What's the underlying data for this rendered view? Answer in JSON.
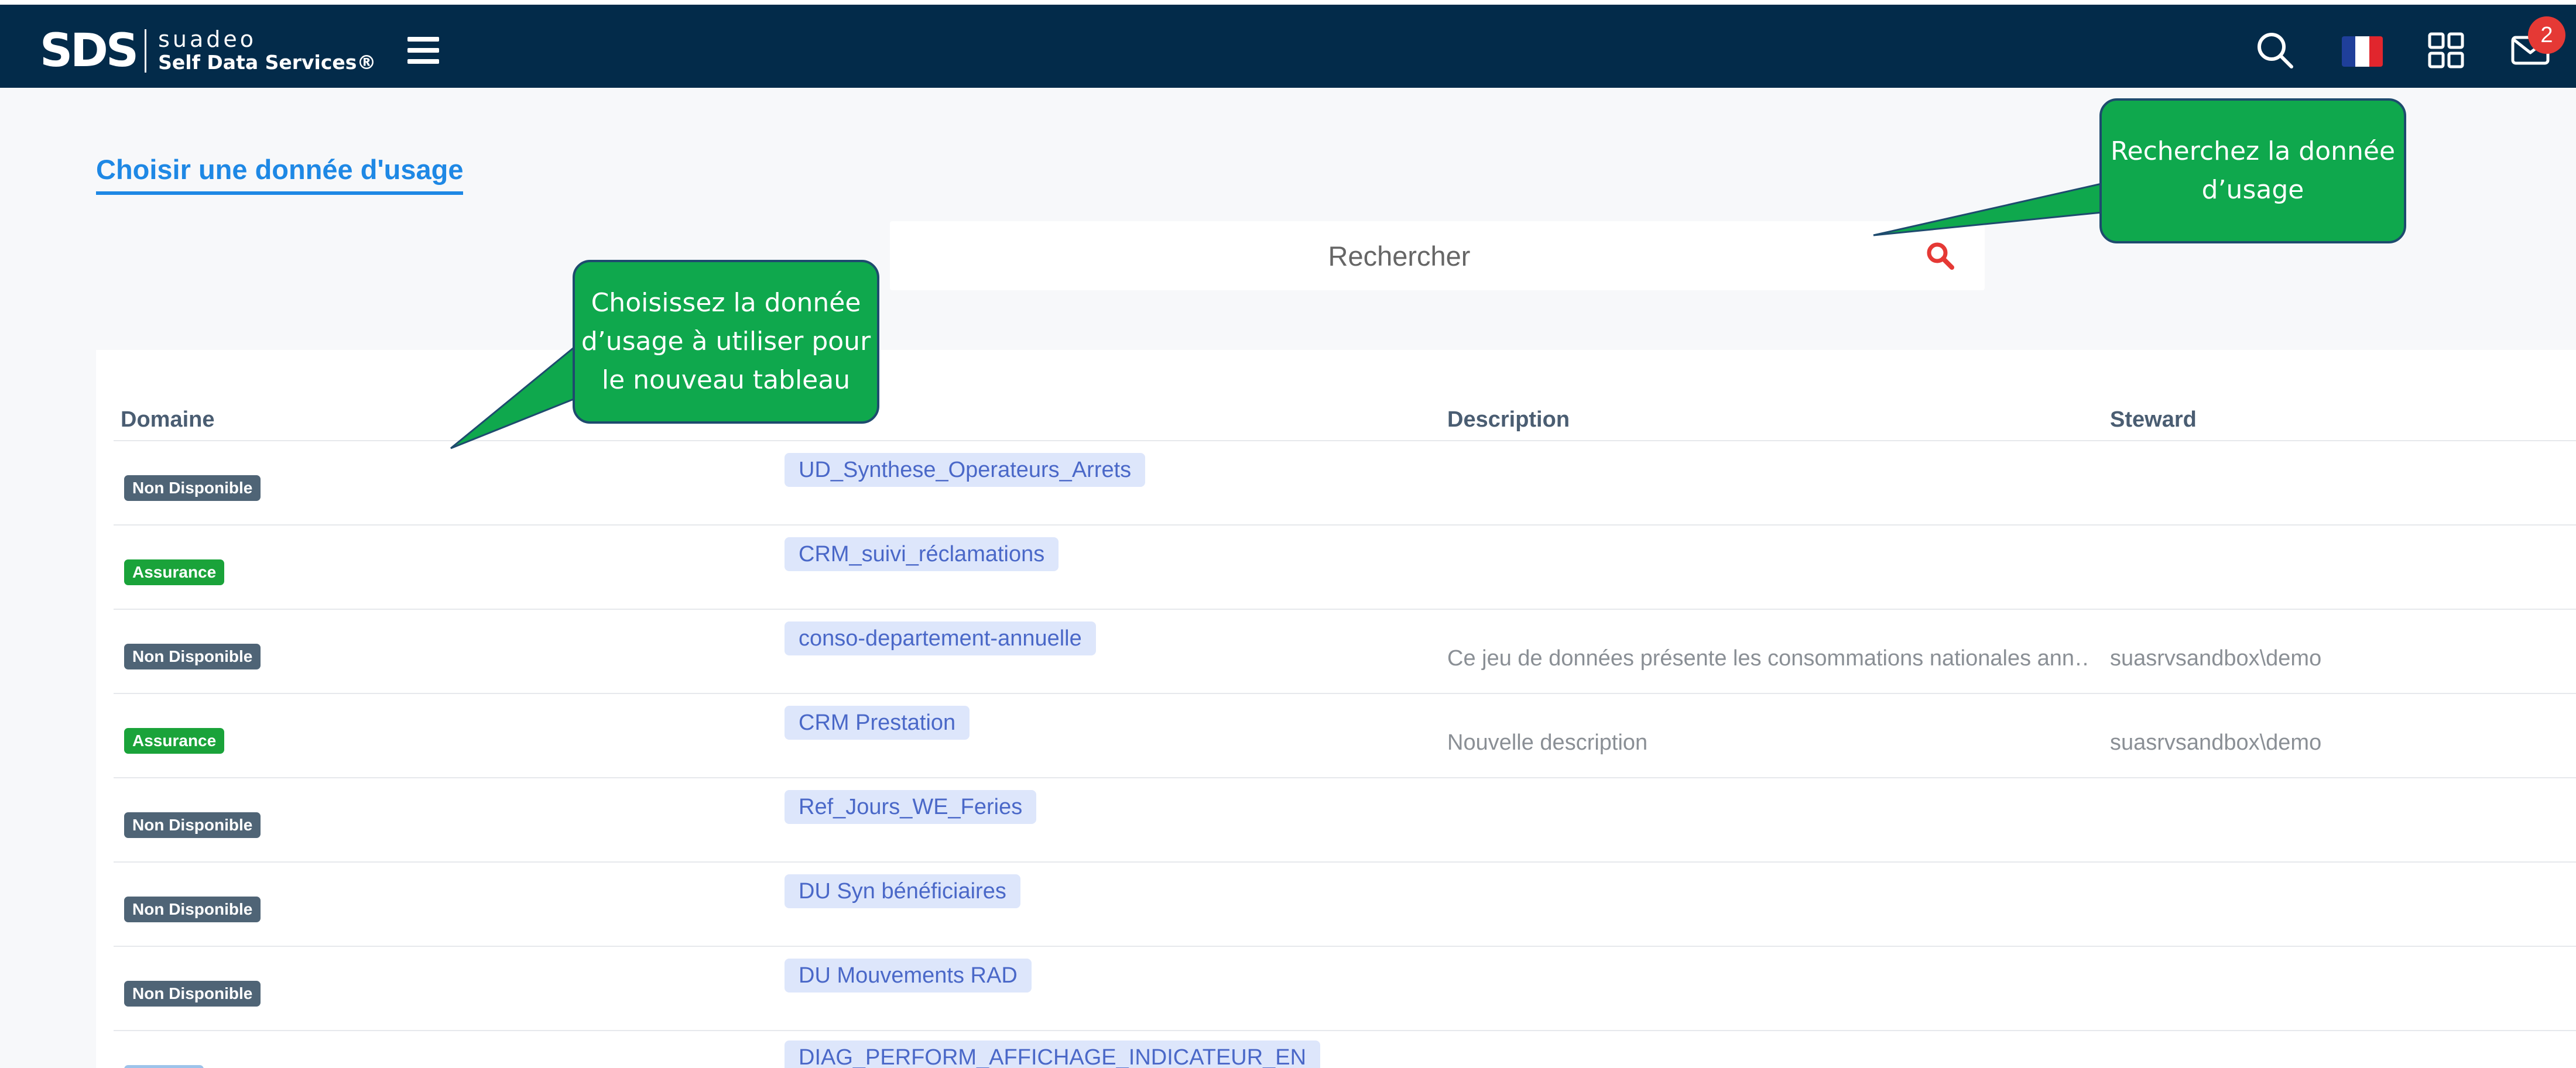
{
  "header": {
    "logo_mark": "SDS",
    "brand_name": "suadeo",
    "brand_tagline": "Self Data Services®",
    "notification_count": "2",
    "flag_colors": [
      "#1f3f9a",
      "#ffffff",
      "#e1262d"
    ]
  },
  "page": {
    "title": "Choisir une donnée d'usage",
    "search_placeholder": "Rechercher"
  },
  "table": {
    "columns": [
      "Domaine",
      "",
      "Description",
      "Steward"
    ],
    "rows": [
      {
        "domain": "Non Disponible",
        "domain_color": "#4f6476",
        "name": "UD_Synthese_Operateurs_Arrets",
        "description": "",
        "steward": ""
      },
      {
        "domain": "Assurance",
        "domain_color": "#1aa33a",
        "name": "CRM_suivi_réclamations",
        "description": "",
        "steward": ""
      },
      {
        "domain": "Non Disponible",
        "domain_color": "#4f6476",
        "name": "conso-departement-annuelle",
        "description": "Ce jeu de données présente les consommations nationales ann…",
        "steward": "suasrvsandbox\\demo"
      },
      {
        "domain": "Assurance",
        "domain_color": "#1aa33a",
        "name": "CRM Prestation",
        "description": "Nouvelle description",
        "steward": "suasrvsandbox\\demo"
      },
      {
        "domain": "Non Disponible",
        "domain_color": "#4f6476",
        "name": "Ref_Jours_WE_Feries",
        "description": "",
        "steward": ""
      },
      {
        "domain": "Non Disponible",
        "domain_color": "#4f6476",
        "name": "DU Syn bénéficiaires",
        "description": "",
        "steward": ""
      },
      {
        "domain": "Non Disponible",
        "domain_color": "#4f6476",
        "name": "DU Mouvements RAD",
        "description": "",
        "steward": ""
      },
      {
        "domain": "",
        "domain_color": "#9dc3ea",
        "name": "DIAG_PERFORM_AFFICHAGE_INDICATEUR_EN",
        "description": "",
        "steward": ""
      }
    ]
  },
  "callouts": {
    "search_hint": "Recherchez la donnée d’usage",
    "choose_hint": "Choisissez la donnée d’usage à utiliser pour le nouveau tableau"
  },
  "icons": {
    "header_search": "search-icon",
    "menu": "hamburger-menu-icon",
    "language": "french-flag-icon",
    "apps": "apps-grid-icon",
    "messages": "mail-icon",
    "search_submit": "search-icon"
  },
  "colors": {
    "header_bg": "#032b4a",
    "accent": "#1e88e5",
    "callout_bg": "#0fa84d",
    "badge": "#e53935"
  }
}
